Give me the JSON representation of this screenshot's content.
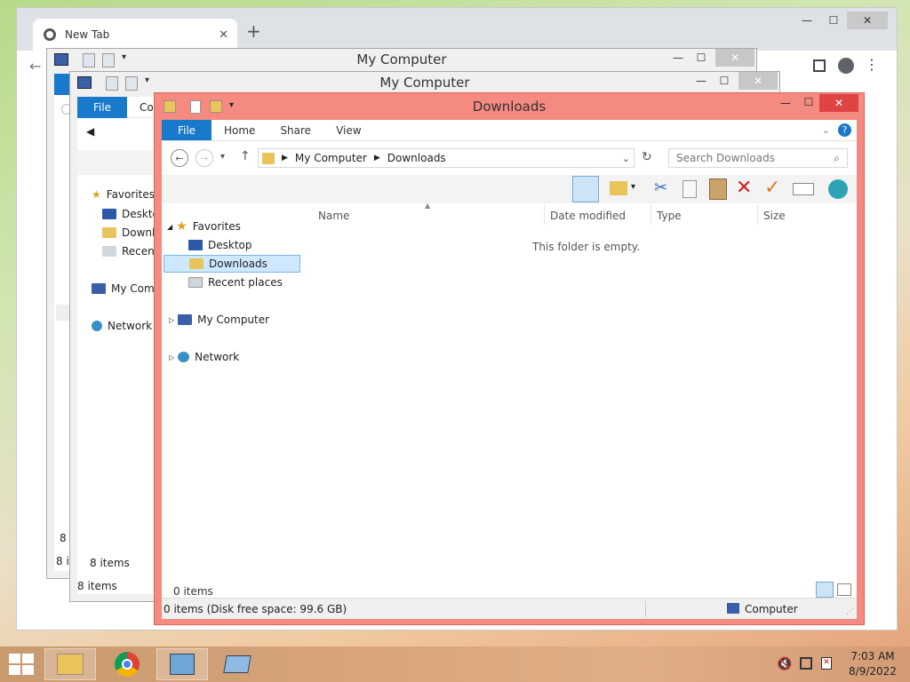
{
  "chrome": {
    "tab_title": "New Tab",
    "tab_close": "✕",
    "new_tab": "+",
    "min": "—",
    "max": "☐",
    "close": "✕"
  },
  "back_win": {
    "title": "My Computer",
    "status_count": "8 it",
    "status_count2": "8 items",
    "pane": [
      "Favorites",
      "Deskto",
      "Downl",
      "Recent",
      "My Comp",
      "Network"
    ],
    "file": "File",
    "other_tab": "Co",
    "num8": "8"
  },
  "mid_win": {
    "title": "My Computer",
    "status": "8 items",
    "file": "File"
  },
  "main": {
    "title": "Downloads",
    "ribbon": {
      "file": "File",
      "home": "Home",
      "share": "Share",
      "view": "View"
    },
    "address": {
      "root": "My Computer",
      "current": "Downloads"
    },
    "search": {
      "placeholder": "Search Downloads"
    },
    "pane": {
      "favorites": "Favorites",
      "desktop": "Desktop",
      "downloads": "Downloads",
      "recent": "Recent places",
      "computer": "My Computer",
      "network": "Network"
    },
    "columns": {
      "name": "Name",
      "date": "Date modified",
      "type": "Type",
      "size": "Size"
    },
    "empty": "This folder is empty.",
    "count": "0 items",
    "status": "0 items (Disk free space: 99.6 GB)",
    "status_computer": "Computer"
  },
  "taskbar": {
    "time": "7:03 AM",
    "date": "8/9/2022"
  },
  "colors": {
    "accent": "#1979ca",
    "active_title": "#f58a80"
  }
}
